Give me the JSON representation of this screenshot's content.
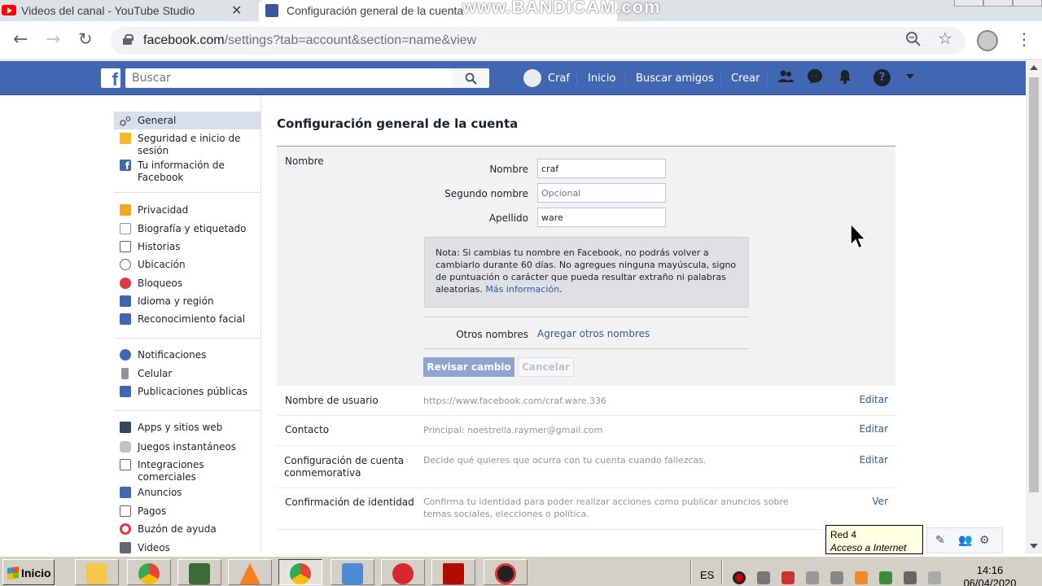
{
  "browser": {
    "tabs": [
      {
        "title": "Videos del canal - YouTube Studio",
        "close": "✕"
      },
      {
        "title": "Configuración general de la cuenta"
      }
    ],
    "watermark": "www.BANDICAM.com",
    "url_host": "facebook.com",
    "url_path": "/settings?tab=account&section=name&view"
  },
  "fb": {
    "logo": "f",
    "search_placeholder": "Buscar",
    "nav": {
      "profile": "Craf",
      "home": "Inicio",
      "find_friends": "Buscar amigos",
      "create": "Crear"
    }
  },
  "sidebar": {
    "items": [
      {
        "label": "General",
        "icon": "gear-icon",
        "color": "#606770"
      },
      {
        "label": "Seguridad e inicio de sesión",
        "icon": "shield-icon",
        "color": "#f7b928"
      },
      {
        "label": "Tu información de Facebook",
        "icon": "facebook-icon",
        "color": "#4267b2"
      },
      {
        "label": "Privacidad",
        "icon": "lock-icon",
        "color": "#f5a623"
      },
      {
        "label": "Biografía y etiquetado",
        "icon": "timeline-icon",
        "color": "#8d949e"
      },
      {
        "label": "Historias",
        "icon": "book-icon",
        "color": "#606770"
      },
      {
        "label": "Ubicación",
        "icon": "location-icon",
        "color": "#606770"
      },
      {
        "label": "Bloqueos",
        "icon": "block-icon",
        "color": "#e0393e"
      },
      {
        "label": "Idioma y región",
        "icon": "language-icon",
        "color": "#4267b2"
      },
      {
        "label": "Reconocimiento facial",
        "icon": "face-icon",
        "color": "#4267b2"
      },
      {
        "label": "Notificaciones",
        "icon": "globe-icon",
        "color": "#4267b2"
      },
      {
        "label": "Celular",
        "icon": "phone-icon",
        "color": "#8d949e"
      },
      {
        "label": "Publicaciones públicas",
        "icon": "rss-icon",
        "color": "#4267b2"
      },
      {
        "label": "Apps y sitios web",
        "icon": "apps-icon",
        "color": "#35465c"
      },
      {
        "label": "Juegos instantáneos",
        "icon": "gamepad-icon",
        "color": "#8d949e"
      },
      {
        "label": "Integraciones comerciales",
        "icon": "integrations-icon",
        "color": "#606770"
      },
      {
        "label": "Anuncios",
        "icon": "ads-icon",
        "color": "#4267b2"
      },
      {
        "label": "Pagos",
        "icon": "card-icon",
        "color": "#606770"
      },
      {
        "label": "Buzón de ayuda",
        "icon": "lifebuoy-icon",
        "color": "#e0393e"
      },
      {
        "label": "Videos",
        "icon": "film-icon",
        "color": "#606770"
      }
    ]
  },
  "main": {
    "title": "Configuración general de la cuenta",
    "name_section": {
      "label": "Nombre",
      "first_label": "Nombre",
      "first_value": "craf",
      "middle_label": "Segundo nombre",
      "middle_placeholder": "Opcional",
      "last_label": "Apellido",
      "last_value": "ware",
      "note": "Nota: Si cambias tu nombre en Facebook, no podrás volver a cambiarlo durante 60 días. No agregues ninguna mayúscula, signo de puntuación o carácter que pueda resultar extraño ni palabras aleatorias.",
      "note_link": "Más información",
      "other_names_label": "Otros nombres",
      "other_names_link": "Agregar otros nombres",
      "review_button": "Revisar cambio",
      "cancel_button": "Cancelar"
    },
    "rows": [
      {
        "label": "Nombre de usuario",
        "value": "https://www.facebook.com/craf.ware.336",
        "action": "Editar"
      },
      {
        "label": "Contacto",
        "value": "Principal: noestrella.raymer@gmail.com",
        "action": "Editar"
      },
      {
        "label": "Configuración de cuenta conmemorativa",
        "value": "Decide qué quieres que ocurra con tu cuenta cuando fallezcas.",
        "action": "Editar"
      },
      {
        "label": "Confirmación de identidad",
        "value": "Confirma tu identidad para poder realizar acciones como publicar anuncios sobre temas sociales, elecciones o política.",
        "action": "Ver"
      }
    ]
  },
  "tooltip": {
    "line1": "Red  4",
    "line2": "Acceso a Internet"
  },
  "taskbar": {
    "start": "Inicio",
    "lang": "ES",
    "time": "14:16",
    "date": "06/04/2020"
  },
  "colors": {
    "fb_blue": "#4267b2",
    "link": "#365899",
    "panel": "#f2f2f2"
  }
}
